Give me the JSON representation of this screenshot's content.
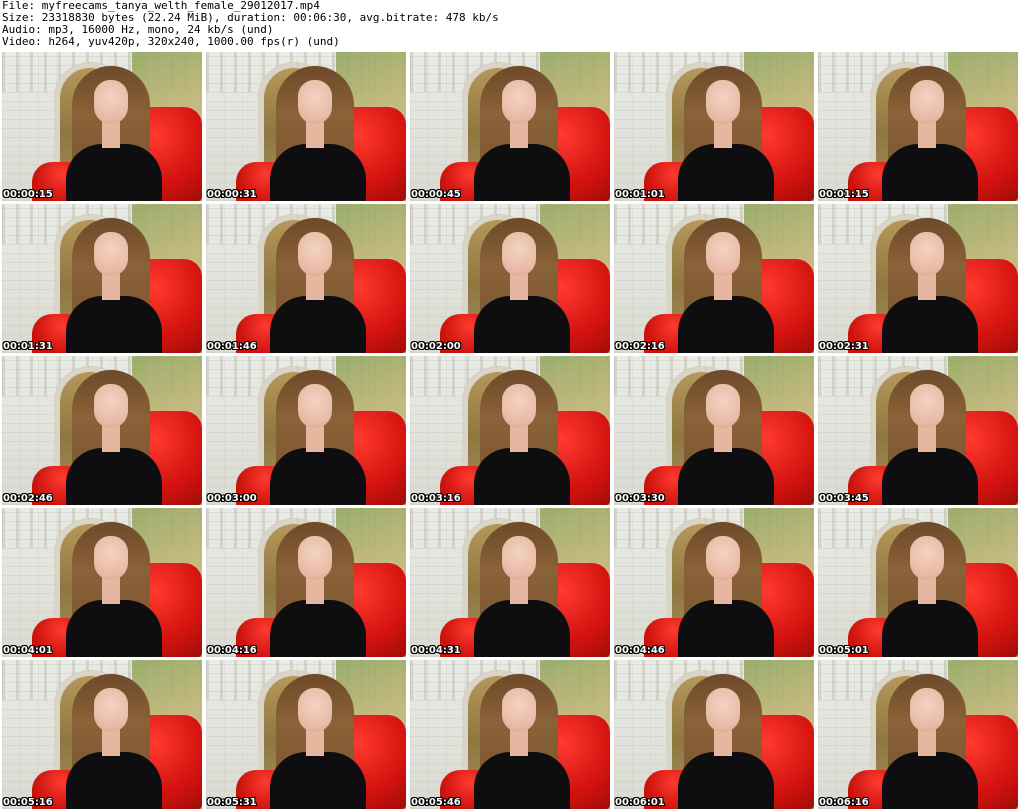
{
  "header": {
    "file_line": "File: myfreecams_tanya_welth_female_29012017.mp4",
    "size_line": "Size: 23318830 bytes (22.24 MiB), duration: 00:06:30, avg.bitrate: 478 kb/s",
    "audio_line": "Audio: mp3, 16000 Hz, mono, 24 kb/s (und)",
    "video_line": "Video: h264, yuv420p, 320x240, 1000.00 fps(r) (und)"
  },
  "thumbnails": [
    {
      "timestamp": "00:00:15"
    },
    {
      "timestamp": "00:00:31"
    },
    {
      "timestamp": "00:00:45"
    },
    {
      "timestamp": "00:01:01"
    },
    {
      "timestamp": "00:01:15"
    },
    {
      "timestamp": "00:01:31"
    },
    {
      "timestamp": "00:01:46"
    },
    {
      "timestamp": "00:02:00"
    },
    {
      "timestamp": "00:02:16"
    },
    {
      "timestamp": "00:02:31"
    },
    {
      "timestamp": "00:02:46"
    },
    {
      "timestamp": "00:03:00"
    },
    {
      "timestamp": "00:03:16"
    },
    {
      "timestamp": "00:03:30"
    },
    {
      "timestamp": "00:03:45"
    },
    {
      "timestamp": "00:04:01"
    },
    {
      "timestamp": "00:04:16"
    },
    {
      "timestamp": "00:04:31"
    },
    {
      "timestamp": "00:04:46"
    },
    {
      "timestamp": "00:05:01"
    },
    {
      "timestamp": "00:05:16"
    },
    {
      "timestamp": "00:05:31"
    },
    {
      "timestamp": "00:05:46"
    },
    {
      "timestamp": "00:06:01"
    },
    {
      "timestamp": "00:06:16"
    }
  ]
}
